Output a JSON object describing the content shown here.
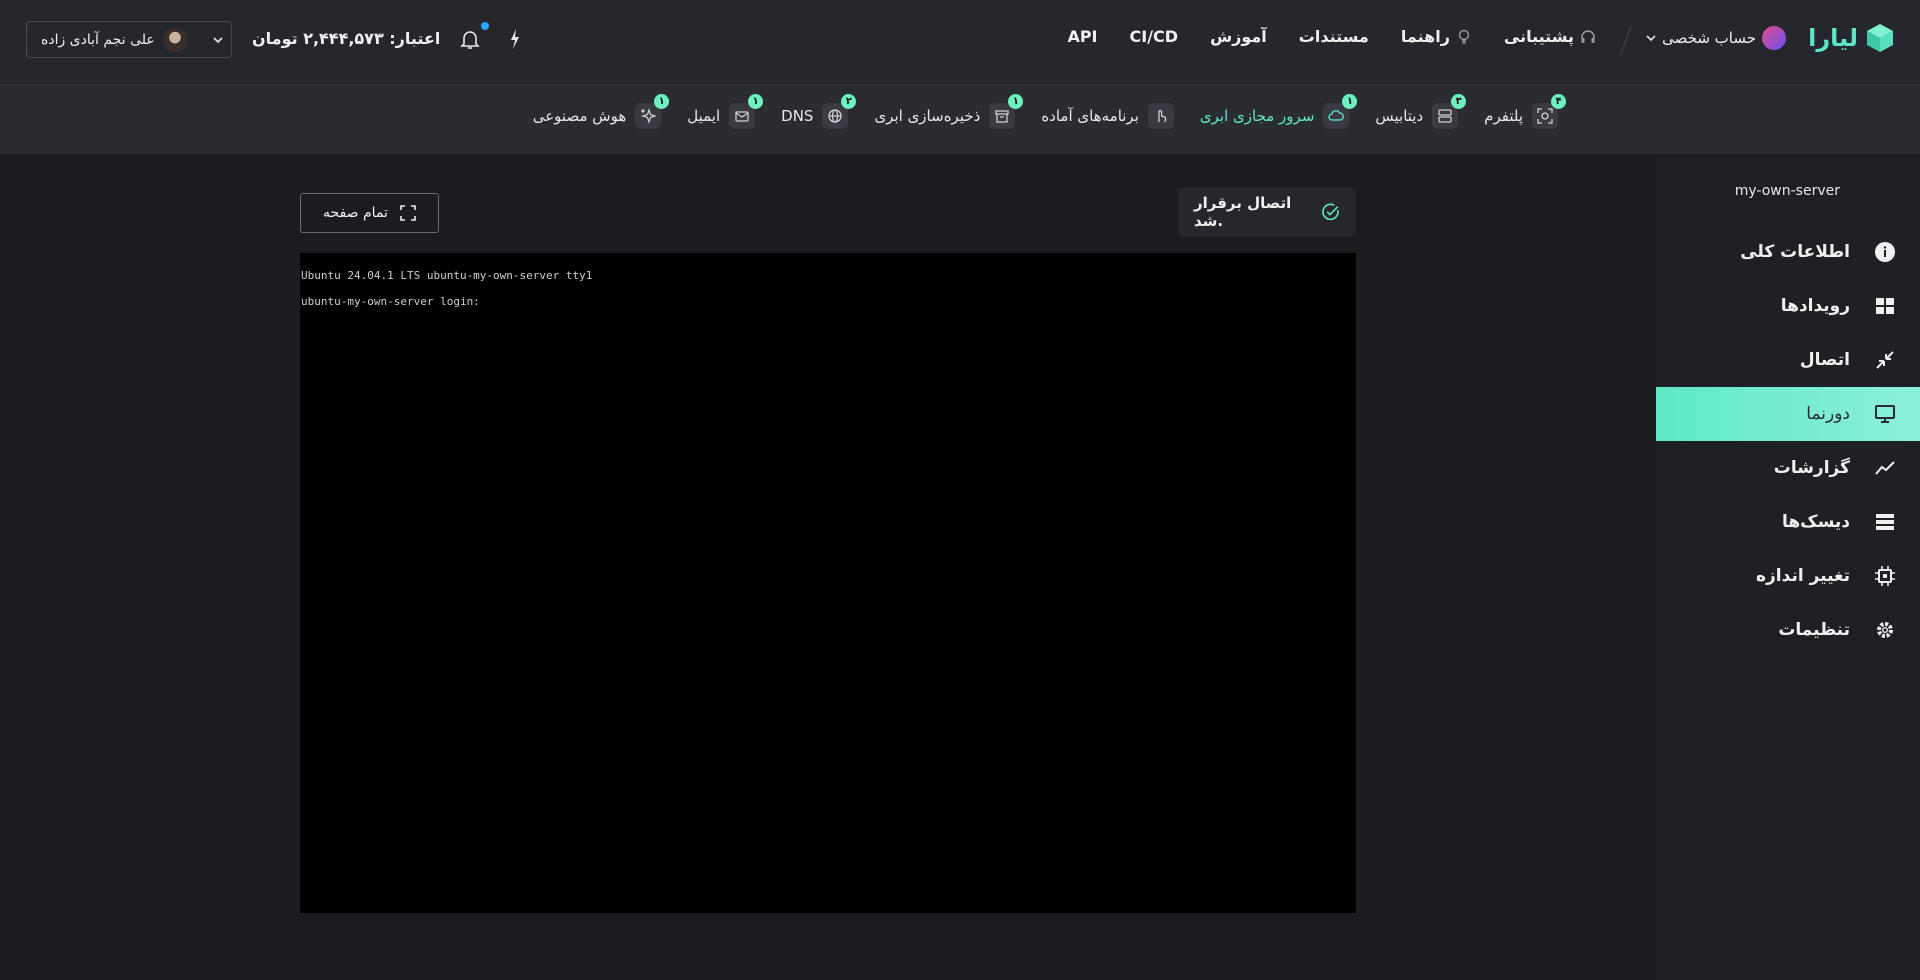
{
  "header": {
    "logo_text": "لیارا",
    "account_label": "حساب شخصی",
    "nav": [
      {
        "label": "پشتیبانی",
        "icon": "headphones-icon"
      },
      {
        "label": "راهنما",
        "icon": "lightbulb-icon"
      },
      {
        "label": "مستندات"
      },
      {
        "label": "آموزش"
      },
      {
        "label": "CI/CD"
      },
      {
        "label": "API"
      }
    ],
    "credit": "اعتبار: ۲,۴۴۴,۵۷۳ تومان",
    "user_name": "علی نجم آبادی زاده"
  },
  "products": [
    {
      "label": "پلتفرم",
      "count": "۴",
      "icon": "platform-icon"
    },
    {
      "label": "دیتابیس",
      "count": "۳",
      "icon": "database-icon"
    },
    {
      "label": "سرور مجازی ابری",
      "count": "۱",
      "icon": "cloud-icon",
      "active": true
    },
    {
      "label": "برنامه‌های آماده",
      "count": "",
      "icon": "touch-icon"
    },
    {
      "label": "ذخیره‌سازی ابری",
      "count": "۱",
      "icon": "archive-icon"
    },
    {
      "label": "DNS",
      "count": "۲",
      "icon": "globe-icon"
    },
    {
      "label": "ایمیل",
      "count": "۱",
      "icon": "mail-icon"
    },
    {
      "label": "هوش مصنوعی",
      "count": "۱",
      "icon": "sparkle-icon"
    }
  ],
  "sidebar": {
    "server_name": "my-own-server",
    "items": [
      {
        "label": "اطلاعات کلی",
        "icon": "info-icon"
      },
      {
        "label": "رویدادها",
        "icon": "grid-icon"
      },
      {
        "label": "اتصال",
        "icon": "connect-icon"
      },
      {
        "label": "دورنما",
        "icon": "monitor-icon",
        "active": true
      },
      {
        "label": "گزارشات",
        "icon": "chart-line-icon"
      },
      {
        "label": "دیسک‌ها",
        "icon": "disks-icon"
      },
      {
        "label": "تغییر اندازه",
        "icon": "cpu-icon"
      },
      {
        "label": "تنظیمات",
        "icon": "gear-icon"
      }
    ]
  },
  "main": {
    "connection_status": "اتصال برقرار شد.",
    "fullscreen_label": "تمام صفحه",
    "terminal_lines": [
      "Ubuntu 24.04.1 LTS ubuntu-my-own-server tty1",
      "ubuntu-my-own-server login:"
    ]
  },
  "colors": {
    "accent": "#5ee6c4",
    "badge": "#6ff0c0",
    "notification_dot": "#2ca7ff",
    "active_gradient_start": "#5fe9c4",
    "active_gradient_end": "#8cf0d8"
  }
}
